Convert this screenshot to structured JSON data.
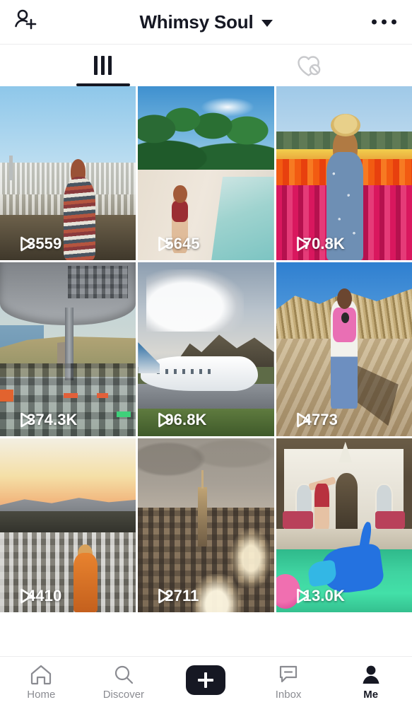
{
  "header": {
    "add_friends_icon": "person-add-icon",
    "title": "Whimsy Soul",
    "dropdown_icon": "chevron-down-icon",
    "more_icon": "more-options-icon"
  },
  "tabs": [
    {
      "id": "posts",
      "icon": "grid-icon",
      "label": "Posts",
      "active": true
    },
    {
      "id": "liked",
      "icon": "heart-slash-icon",
      "label": "Liked",
      "active": false
    }
  ],
  "grid": {
    "play_icon": "play-icon",
    "videos": [
      {
        "views": "3559",
        "alt": "San Francisco cityscape from hilltop with woman in striped poncho"
      },
      {
        "views": "5645",
        "alt": "Tropical beach with palm trees and woman in red swimsuit"
      },
      {
        "views": "70.8K",
        "alt": "Flower fields with woman in blue floral dress and straw hat"
      },
      {
        "views": "374.3K",
        "alt": "Airplane cockpit view approaching island runway"
      },
      {
        "views": "96.8K",
        "alt": "Turboprop airplane on wet tarmac with mountains"
      },
      {
        "views": "4773",
        "alt": "Woman with pink pet backpack walking up sand dunes"
      },
      {
        "views": "4410",
        "alt": "Sunset over city with woman in orange dress"
      },
      {
        "views": "2711",
        "alt": "New York City skyline at dusk with Empire State Building"
      },
      {
        "views": "13.0K",
        "alt": "Woman jumping into pool with blue swan float and pink flamingo"
      }
    ]
  },
  "bottom_nav": {
    "items": [
      {
        "id": "home",
        "label": "Home",
        "icon": "home-icon",
        "active": false
      },
      {
        "id": "discover",
        "label": "Discover",
        "icon": "search-icon",
        "active": false
      },
      {
        "id": "create",
        "label": "",
        "icon": "plus-icon",
        "active": false
      },
      {
        "id": "inbox",
        "label": "Inbox",
        "icon": "message-icon",
        "active": false
      },
      {
        "id": "me",
        "label": "Me",
        "icon": "person-icon",
        "active": true
      }
    ]
  },
  "colors": {
    "text_primary": "#161823",
    "text_muted": "#8a8b91",
    "accent_cyan": "#25F4EE",
    "accent_pink": "#FE2C55",
    "background": "#FFFFFF",
    "divider": "#ECECEE"
  }
}
